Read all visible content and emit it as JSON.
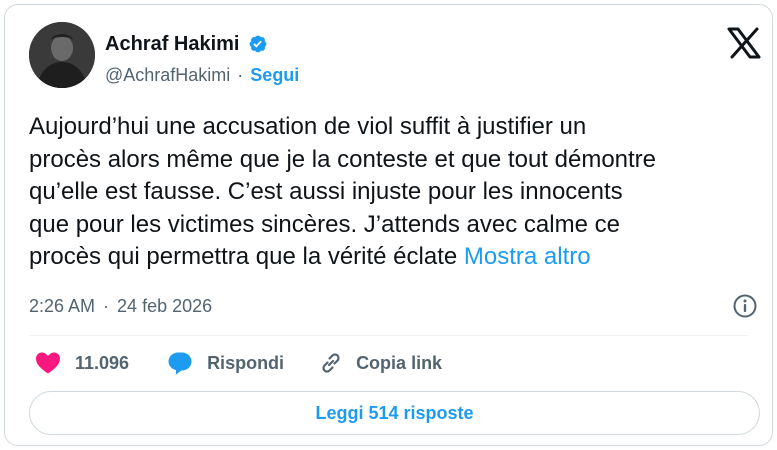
{
  "author": {
    "name": "Achraf Hakimi",
    "handle": "@AchrafHakimi",
    "separator": "·",
    "follow_label": "Segui"
  },
  "tweet": {
    "text": "Aujourd’hui une accusation de viol suffit à justifier un\nprocès alors même que je la conteste et que tout démontre\nqu’elle est fausse. C’est aussi injuste pour les innocents\nque pour les victimes sincères. J’attends avec calme ce\nprocès qui permettra que la vérité éclate",
    "show_more": "Mostra altro",
    "time": "2:26 AM",
    "separator": "·",
    "date": "24 feb 2026"
  },
  "actions": {
    "likes": "11.096",
    "reply": "Rispondi",
    "copy_link": "Copia link"
  },
  "read_replies": "Leggi 514 risposte",
  "icons": {
    "verified": "verified-badge-icon",
    "platform": "x-logo-icon",
    "info": "info-icon",
    "like": "heart-icon",
    "reply": "speech-bubble-icon",
    "copy_link": "link-icon"
  },
  "colors": {
    "accent": "#1d9bf0",
    "like": "#f91880",
    "text": "#0f1419",
    "muted": "#536471",
    "border": "#cfd9de"
  }
}
